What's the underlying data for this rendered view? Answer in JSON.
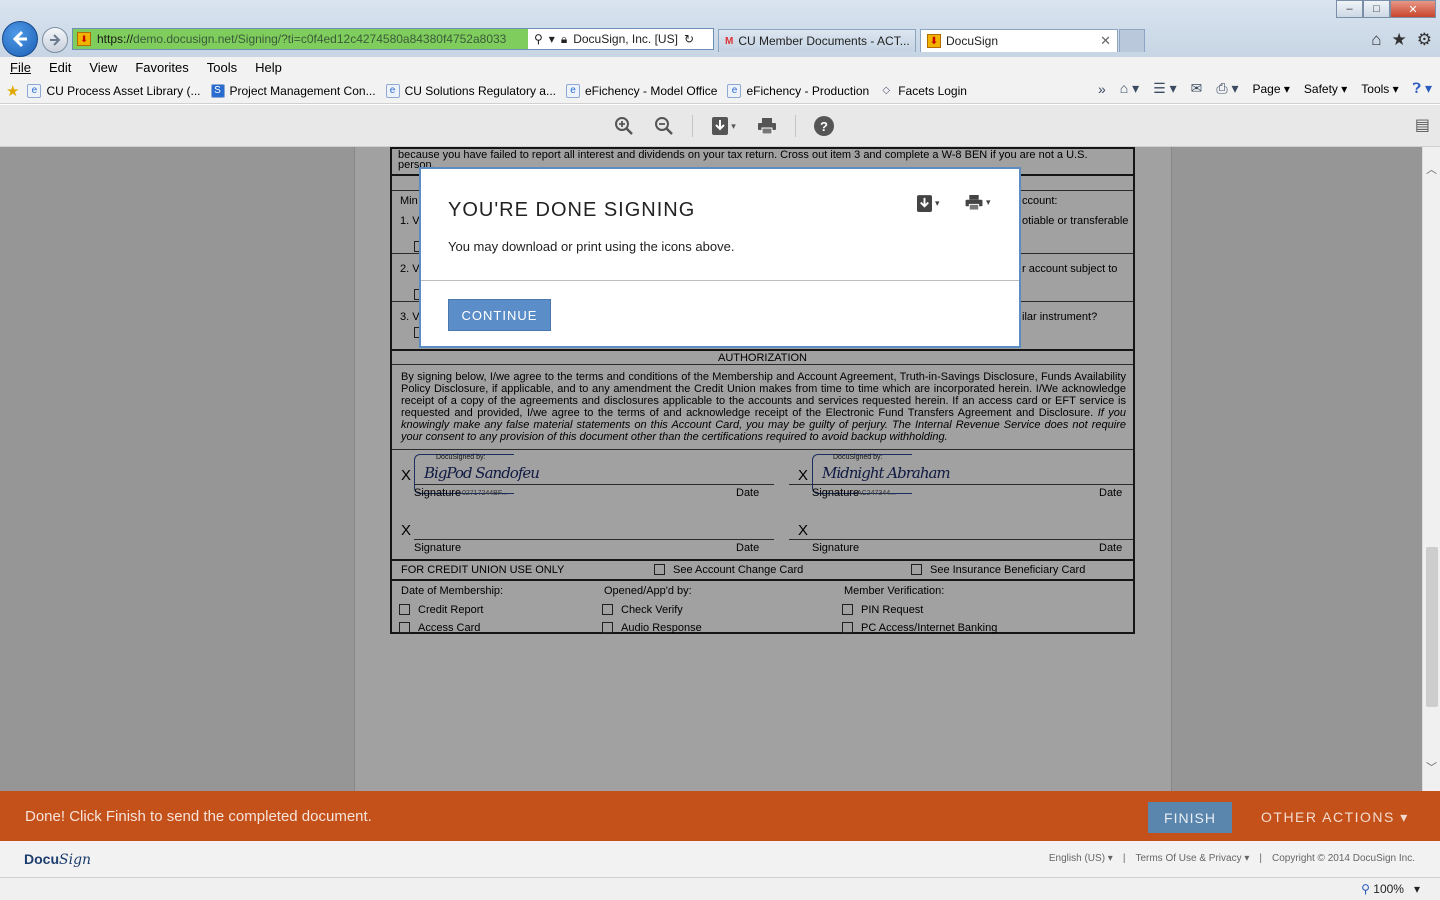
{
  "browser": {
    "url_prefix": "https://",
    "url_domain": "demo.docusign.net",
    "url_rest": "/Signing/?ti=c0f4ed12c4274580a84380f4752a8033",
    "cert_label": "DocuSign, Inc. [US]",
    "tabs": [
      {
        "label": "CU Member Documents - ACT..."
      },
      {
        "label": "DocuSign"
      }
    ],
    "window_buttons": {
      "minimize": "–",
      "maximize": "□",
      "close": "✕"
    }
  },
  "menu": [
    "File",
    "Edit",
    "View",
    "Favorites",
    "Tools",
    "Help"
  ],
  "favorites": [
    "CU Process Asset Library (...",
    "Project Management Con...",
    "CU Solutions Regulatory a...",
    "eFichency - Model Office",
    "eFichency - Production",
    "Facets Login"
  ],
  "command_bar": {
    "page": "Page",
    "safety": "Safety",
    "tools": "Tools"
  },
  "document": {
    "top_text": "because you have failed to report all interest and dividends on your tax return. Cross out item 3 and complete a W-8 BEN if you are not a U.S.",
    "top_text2": "person.",
    "mini_label": "Min",
    "item1": "1. V",
    "item2": "2. V",
    "item3": "3. V",
    "right_a": "ccount:",
    "right_b": "otiable or transferable",
    "right_c": "r account subject to",
    "right_d": "ilar instrument?",
    "auth_header": "AUTHORIZATION",
    "auth_body": "By signing below, I/we agree to the terms and conditions of the Membership and Account Agreement, Truth-in-Savings Disclosure, Funds Availability Policy Disclosure, if applicable, and to any amendment the Credit Union makes from time to time which are incorporated herein. I/We acknowledge receipt of a copy of the agreements and disclosures applicable to the accounts and services requested herein. If an access card or EFT service is requested and provided, I/we agree to the terms of and acknowledge receipt of the Electronic Fund Transfers Agreement and Disclosure.",
    "auth_body_italic": "If you knowingly make any false material statements on this Account Card, you may be guilty of perjury. The Internal Revenue Service does not require your consent to any provision of this document other than the certifications required to avoid backup withholding.",
    "x_mark": "X",
    "signature_label": "Signature",
    "date_label": "Date",
    "docusigned_by": "DocuSigned by:",
    "signer1_sig": "BigPod Sandofeu",
    "signer1_id": "02717244BF...",
    "signer2_sig": "Midnight Abraham",
    "signer2_id": "AC247344...",
    "cu_only": "FOR CREDIT UNION USE ONLY",
    "see_account_change": "See Account Change Card",
    "see_insurance": "See Insurance Beneficiary Card",
    "date_of_membership": "Date of Membership:",
    "opened_by": "Opened/App'd by:",
    "member_verification": "Member Verification:",
    "credit_report": "Credit Report",
    "access_card": "Access Card",
    "check_verify": "Check Verify",
    "audio_response": "Audio Response",
    "pin_request": "PIN Request",
    "pc_access": "PC Access/Internet Banking"
  },
  "modal": {
    "title": "YOU'RE DONE SIGNING",
    "message": "You may download or print using the icons above.",
    "continue_label": "CONTINUE"
  },
  "action_bar": {
    "message": "Done! Click Finish to send the completed document.",
    "finish_label": "FINISH",
    "other_actions_label": "OTHER ACTIONS ▾"
  },
  "footer": {
    "logo_a": "Docu",
    "logo_b": "Sign",
    "language": "English (US) ▾",
    "terms": "Terms Of Use & Privacy ▾",
    "copyright": "Copyright © 2014 DocuSign Inc."
  },
  "status": {
    "zoom": "100%"
  },
  "colors": {
    "action_bar": "#c4501a",
    "finish": "#5a86ad",
    "continue": "#5b8dc8",
    "modal_border": "#5c8cc0"
  }
}
